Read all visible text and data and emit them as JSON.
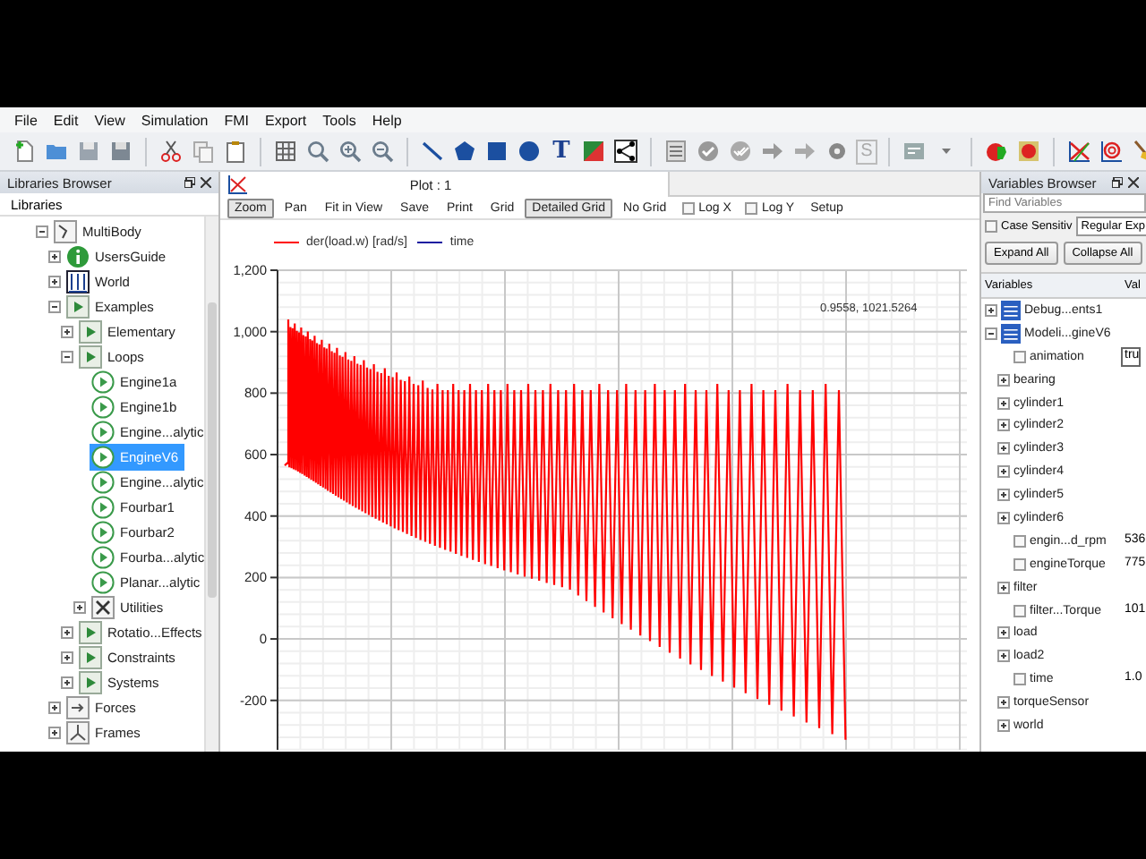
{
  "menu": [
    "File",
    "Edit",
    "View",
    "Simulation",
    "FMI",
    "Export",
    "Tools",
    "Help"
  ],
  "toolbar": {
    "text_tool": "T",
    "s_tool": "S"
  },
  "libraries_browser": {
    "title": "Libraries Browser",
    "header": "Libraries",
    "tree": [
      {
        "label": "MultiBody",
        "kind": "library",
        "expanded": true,
        "selected": false,
        "children": [
          {
            "label": "UsersGuide",
            "kind": "info",
            "expanded": false,
            "selected": false
          },
          {
            "label": "World",
            "kind": "world",
            "expanded": false,
            "selected": false
          },
          {
            "label": "Examples",
            "kind": "package",
            "expanded": true,
            "selected": false,
            "children": [
              {
                "label": "Elementary",
                "kind": "package",
                "expanded": false,
                "selected": false
              },
              {
                "label": "Loops",
                "kind": "package",
                "expanded": true,
                "selected": false,
                "children": [
                  {
                    "label": "Engine1a",
                    "kind": "example",
                    "selected": false
                  },
                  {
                    "label": "Engine1b",
                    "kind": "example",
                    "selected": false
                  },
                  {
                    "label": "Engine...alytic",
                    "kind": "example",
                    "selected": false
                  },
                  {
                    "label": "EngineV6",
                    "kind": "example",
                    "selected": true
                  },
                  {
                    "label": "Engine...alytic",
                    "kind": "example",
                    "selected": false
                  },
                  {
                    "label": "Fourbar1",
                    "kind": "example",
                    "selected": false
                  },
                  {
                    "label": "Fourbar2",
                    "kind": "example",
                    "selected": false
                  },
                  {
                    "label": "Fourba...alytic",
                    "kind": "example",
                    "selected": false
                  },
                  {
                    "label": "Planar...alytic",
                    "kind": "example",
                    "selected": false
                  },
                  {
                    "label": "Utilities",
                    "kind": "utilities",
                    "expanded": false,
                    "selected": false
                  }
                ]
              },
              {
                "label": "Rotatio...Effects",
                "kind": "package",
                "expanded": false,
                "selected": false
              },
              {
                "label": "Constraints",
                "kind": "package",
                "expanded": false,
                "selected": false
              },
              {
                "label": "Systems",
                "kind": "package",
                "expanded": false,
                "selected": false
              }
            ]
          },
          {
            "label": "Forces",
            "kind": "forces",
            "expanded": false,
            "selected": false
          },
          {
            "label": "Frames",
            "kind": "frames",
            "expanded": false,
            "selected": false
          }
        ]
      }
    ]
  },
  "plot_window": {
    "title": "Plot : 1",
    "toolbar": [
      {
        "label": "Zoom",
        "kind": "button",
        "pressed": true
      },
      {
        "label": "Pan",
        "kind": "button",
        "pressed": false
      },
      {
        "label": "Fit in View",
        "kind": "button",
        "pressed": false
      },
      {
        "label": "Save",
        "kind": "button",
        "pressed": false
      },
      {
        "label": "Print",
        "kind": "button",
        "pressed": false
      },
      {
        "label": "Grid",
        "kind": "button",
        "pressed": false
      },
      {
        "label": "Detailed Grid",
        "kind": "button",
        "pressed": true
      },
      {
        "label": "No Grid",
        "kind": "button",
        "pressed": false
      },
      {
        "label": "Log X",
        "kind": "checkbox",
        "checked": false
      },
      {
        "label": "Log Y",
        "kind": "checkbox",
        "checked": false
      },
      {
        "label": "Setup",
        "kind": "button",
        "pressed": false
      }
    ],
    "legend": [
      {
        "label": "der(load.w) [rad/s]",
        "color": "#ff0000"
      },
      {
        "label": "time",
        "color": "#1a1aa0"
      }
    ],
    "readout": "0.9558, 1021.5264",
    "y_ticks": [
      "1,200",
      "1,000",
      "800",
      "600",
      "400",
      "200",
      "0",
      "-200"
    ]
  },
  "variables_browser": {
    "title": "Variables Browser",
    "search": {
      "placeholder": "Find Variables"
    },
    "case_sensitive": {
      "label": "Case Sensitiv",
      "checked": false
    },
    "match_mode": "Regular Exp",
    "buttons": [
      "Expand All",
      "Collapse All"
    ],
    "columns": [
      "Variables",
      "Val"
    ],
    "tree": [
      {
        "label": "Debug...ents1",
        "kind": "model",
        "expanded": false
      },
      {
        "label": "Modeli...gineV6",
        "kind": "model",
        "expanded": true,
        "children": [
          {
            "label": "animation",
            "kind": "variable",
            "checked": false,
            "value": "tru",
            "editing": true
          },
          {
            "label": "bearing",
            "kind": "group",
            "expanded": false
          },
          {
            "label": "cylinder1",
            "kind": "group",
            "expanded": false
          },
          {
            "label": "cylinder2",
            "kind": "group",
            "expanded": false
          },
          {
            "label": "cylinder3",
            "kind": "group",
            "expanded": false
          },
          {
            "label": "cylinder4",
            "kind": "group",
            "expanded": false
          },
          {
            "label": "cylinder5",
            "kind": "group",
            "expanded": false
          },
          {
            "label": "cylinder6",
            "kind": "group",
            "expanded": false
          },
          {
            "label": "engin...d_rpm",
            "kind": "variable",
            "checked": false,
            "value": "536",
            "editing": false
          },
          {
            "label": "engineTorque",
            "kind": "variable",
            "checked": false,
            "value": "775",
            "editing": false
          },
          {
            "label": "filter",
            "kind": "group",
            "expanded": false
          },
          {
            "label": "filter...Torque",
            "kind": "variable",
            "checked": false,
            "value": "101",
            "editing": false
          },
          {
            "label": "load",
            "kind": "group",
            "expanded": false
          },
          {
            "label": "load2",
            "kind": "group",
            "expanded": false
          },
          {
            "label": "time",
            "kind": "variable",
            "checked": false,
            "value": "1.0",
            "editing": false
          },
          {
            "label": "torqueSensor",
            "kind": "group",
            "expanded": false
          },
          {
            "label": "world",
            "kind": "group",
            "expanded": false
          }
        ]
      }
    ]
  }
}
